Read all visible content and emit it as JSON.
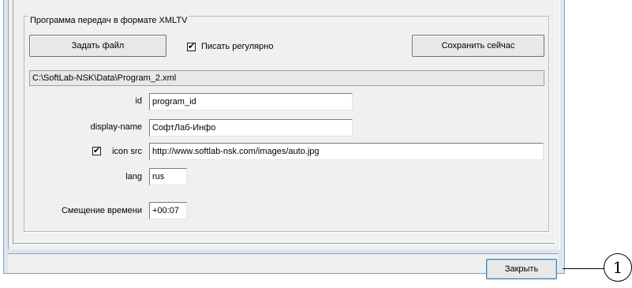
{
  "group": {
    "title": "Программа передач в формате XMLTV"
  },
  "toolbar": {
    "set_file_label": "Задать файл",
    "write_regularly_label": "Писать регулярно",
    "write_regularly_checked": true,
    "save_now_label": "Сохранить сейчас"
  },
  "file_path": "C:\\SoftLab-NSK\\Data\\Program_2.xml",
  "fields": {
    "id": {
      "label": "id",
      "value": "program_id"
    },
    "display_name": {
      "label": "display-name",
      "value": "СофтЛаб-Инфо"
    },
    "icon_src": {
      "label": "icon src",
      "checked": true,
      "value": "http://www.softlab-nsk.com/images/auto.jpg"
    },
    "lang": {
      "label": "lang",
      "value": "rus"
    },
    "time_offset": {
      "label": "Смещение времени",
      "value": "+00:07"
    }
  },
  "close_button": {
    "label": "Закрыть"
  },
  "callout": {
    "number": "1"
  },
  "check_glyph": "✔"
}
